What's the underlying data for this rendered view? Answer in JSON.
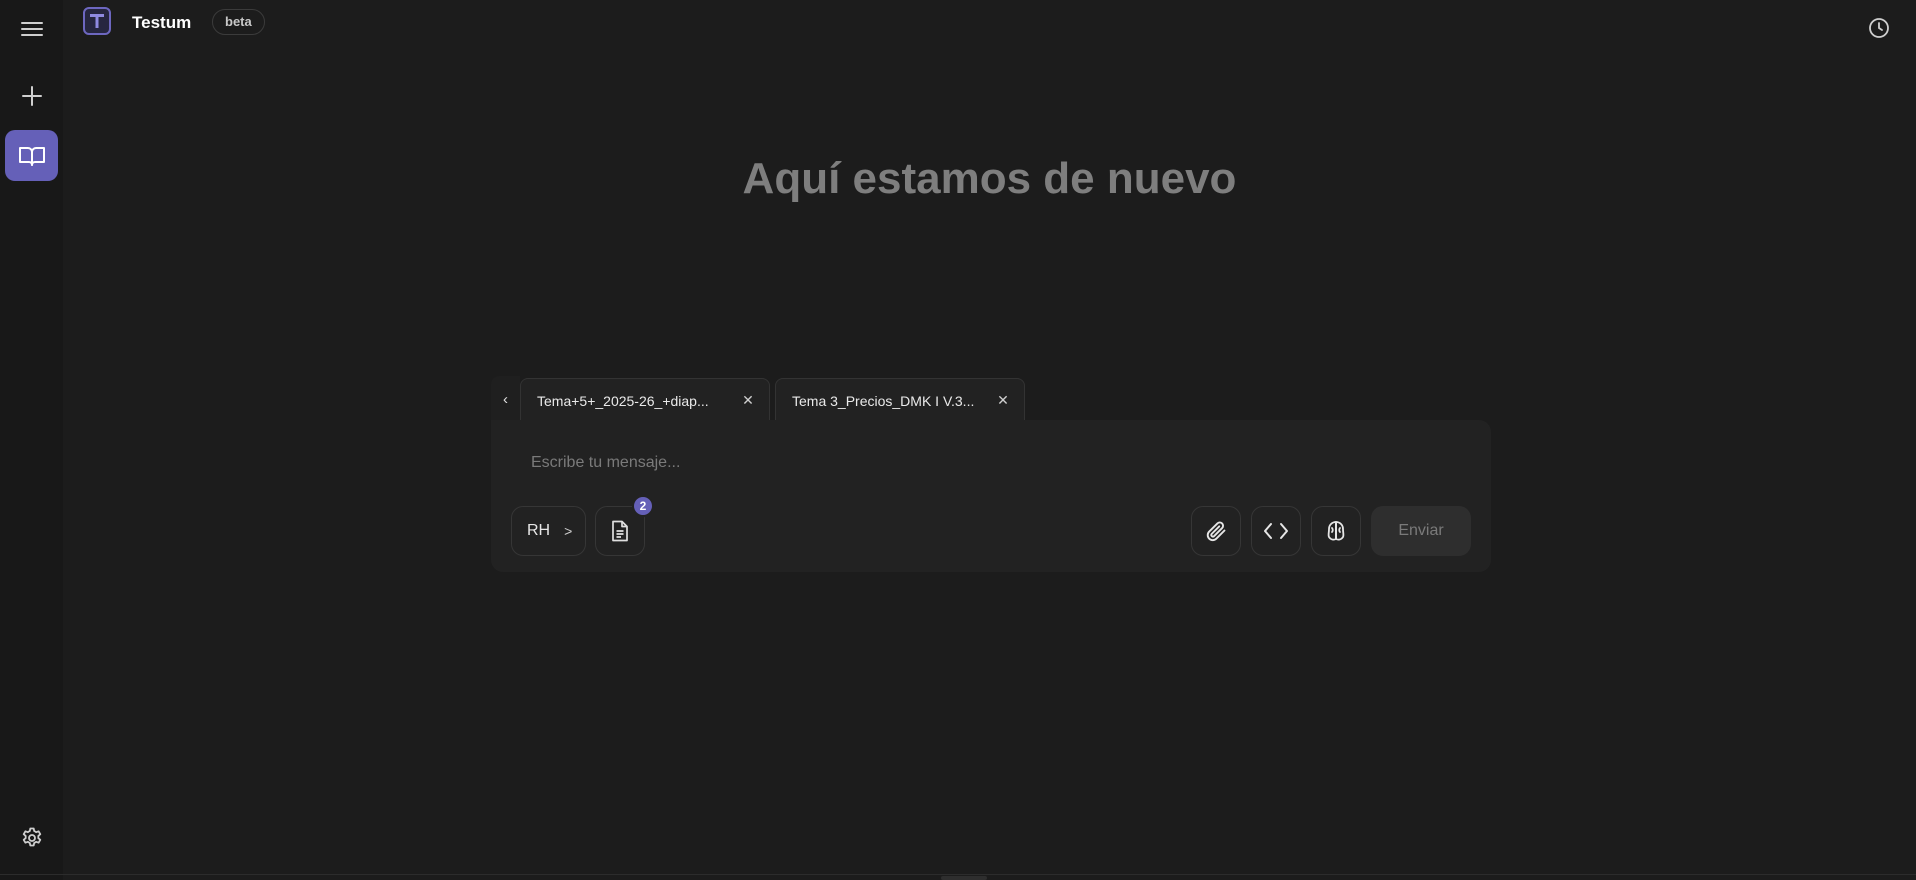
{
  "sidebar": {
    "menu_icon": "hamburger-menu-icon",
    "new_icon": "plus-icon",
    "library_icon": "open-book-icon",
    "settings_icon": "gear-icon"
  },
  "header": {
    "logo_letter": "T",
    "app_name": "Testum",
    "badge": "beta",
    "history_icon": "clock-icon"
  },
  "main": {
    "heading": "Aquí estamos de nuevo"
  },
  "tabs": {
    "prev_icon": "‹",
    "items": [
      {
        "label": "Tema+5+_2025-26_+diap..."
      },
      {
        "label": "Tema 3_Precios_DMK I V.3..."
      }
    ],
    "close_icon": "✕"
  },
  "composer": {
    "placeholder": "Escribe tu mensaje...",
    "model_label": "RH",
    "model_chevron": ">",
    "documents_count": "2",
    "send_label": "Enviar"
  },
  "colors": {
    "background": "#1c1c1c",
    "sidebar": "#181818",
    "accent": "#6560b8"
  }
}
